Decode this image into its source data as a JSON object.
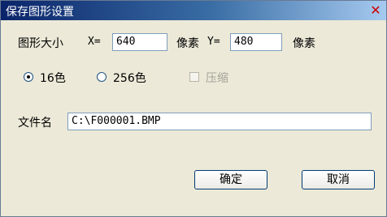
{
  "window": {
    "title": "保存图形设置"
  },
  "size": {
    "label": "图形大小",
    "x_label": "X=",
    "x_value": "640",
    "x_unit": "像素",
    "y_label": "Y=",
    "y_value": "480",
    "y_unit": "像素"
  },
  "color_mode": {
    "options": [
      {
        "label": "16色",
        "selected": true
      },
      {
        "label": "256色",
        "selected": false
      }
    ]
  },
  "compress": {
    "label": "压缩",
    "checked": false,
    "enabled": false
  },
  "filename": {
    "label": "文件名",
    "value": "C:\\F000001.BMP"
  },
  "buttons": {
    "ok": "确定",
    "cancel": "取消"
  }
}
